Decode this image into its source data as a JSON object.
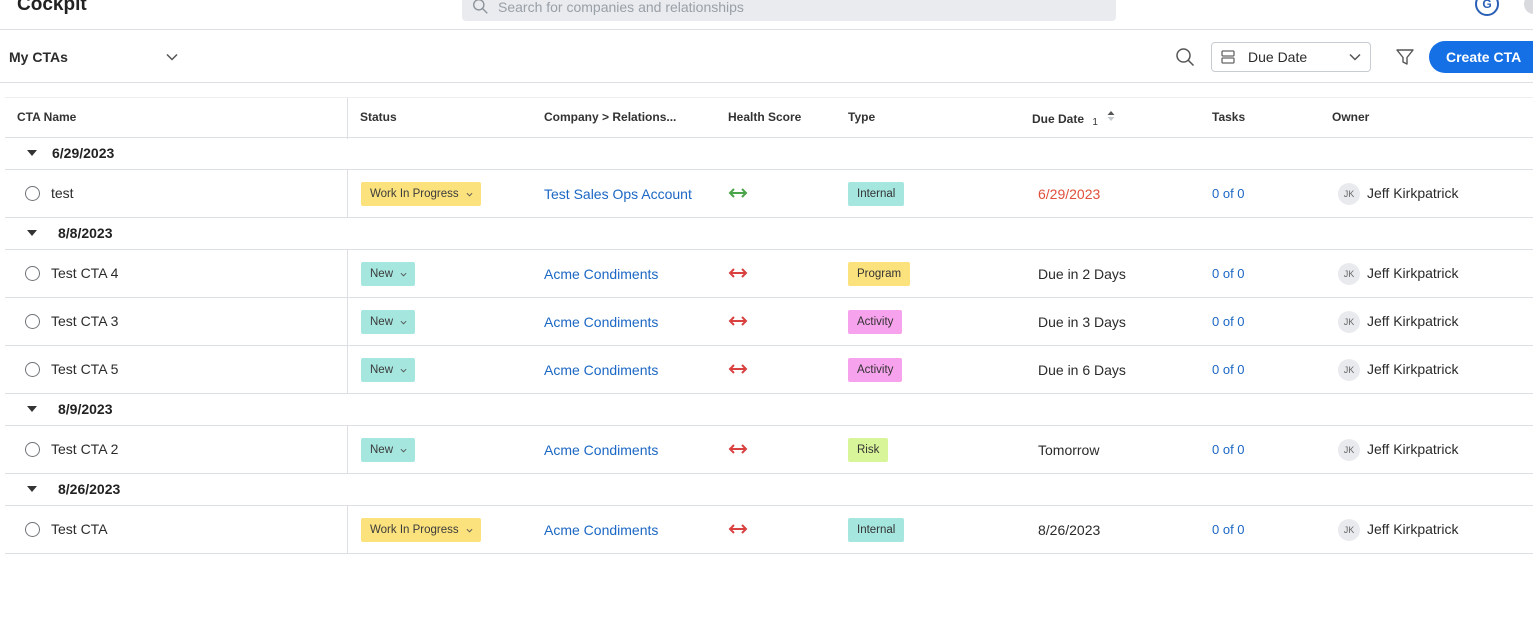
{
  "app": {
    "title": "Cockpit",
    "avatar_initial": "G"
  },
  "search": {
    "placeholder": "Search for companies and relationships"
  },
  "toolbar": {
    "view_label": "My CTAs",
    "sort_label": "Due Date",
    "create_label": "Create CTA"
  },
  "columns": {
    "name": "CTA Name",
    "status": "Status",
    "company": "Company > Relations...",
    "health": "Health Score",
    "type": "Type",
    "due": "Due Date",
    "due_sort_index": "1",
    "tasks": "Tasks",
    "owner": "Owner"
  },
  "colors": {
    "accent": "#1570e6",
    "status_wip": "#fbe27d",
    "status_new": "#a5e6df",
    "type_internal": "#a5e6df",
    "type_program": "#fbe27d",
    "type_activity": "#f6a2ec",
    "type_risk": "#d8f59a",
    "health_good": "#4aa54a",
    "health_bad": "#d94140",
    "overdue": "#e0503c"
  },
  "groups": [
    {
      "label": "6/29/2023",
      "rows": [
        {
          "name": "test",
          "status": "Work In Progress",
          "status_color": "wip",
          "company": "Test Sales Ops Account",
          "health": "good",
          "type": "Internal",
          "type_color": "internal",
          "due": "6/29/2023",
          "overdue": true,
          "tasks": "0 of 0",
          "owner_initials": "JK",
          "owner": "Jeff Kirkpatrick"
        }
      ]
    },
    {
      "label": "8/8/2023",
      "rows": [
        {
          "name": "Test CTA 4",
          "status": "New",
          "status_color": "new",
          "company": "Acme Condiments",
          "health": "bad",
          "type": "Program",
          "type_color": "program",
          "due": "Due in 2 Days",
          "overdue": false,
          "tasks": "0 of 0",
          "owner_initials": "JK",
          "owner": "Jeff Kirkpatrick"
        },
        {
          "name": "Test CTA 3",
          "status": "New",
          "status_color": "new",
          "company": "Acme Condiments",
          "health": "bad",
          "type": "Activity",
          "type_color": "activity",
          "due": "Due in 3 Days",
          "overdue": false,
          "tasks": "0 of 0",
          "owner_initials": "JK",
          "owner": "Jeff Kirkpatrick"
        },
        {
          "name": "Test CTA 5",
          "status": "New",
          "status_color": "new",
          "company": "Acme Condiments",
          "health": "bad",
          "type": "Activity",
          "type_color": "activity",
          "due": "Due in 6 Days",
          "overdue": false,
          "tasks": "0 of 0",
          "owner_initials": "JK",
          "owner": "Jeff Kirkpatrick"
        }
      ]
    },
    {
      "label": "8/9/2023",
      "rows": [
        {
          "name": "Test CTA 2",
          "status": "New",
          "status_color": "new",
          "company": "Acme Condiments",
          "health": "bad",
          "type": "Risk",
          "type_color": "risk",
          "due": "Tomorrow",
          "overdue": false,
          "tasks": "0 of 0",
          "owner_initials": "JK",
          "owner": "Jeff Kirkpatrick"
        }
      ]
    },
    {
      "label": "8/26/2023",
      "rows": [
        {
          "name": "Test CTA",
          "status": "Work In Progress",
          "status_color": "wip",
          "company": "Acme Condiments",
          "health": "bad",
          "type": "Internal",
          "type_color": "internal",
          "due": "8/26/2023",
          "overdue": false,
          "tasks": "0 of 0",
          "owner_initials": "JK",
          "owner": "Jeff Kirkpatrick"
        }
      ]
    }
  ]
}
